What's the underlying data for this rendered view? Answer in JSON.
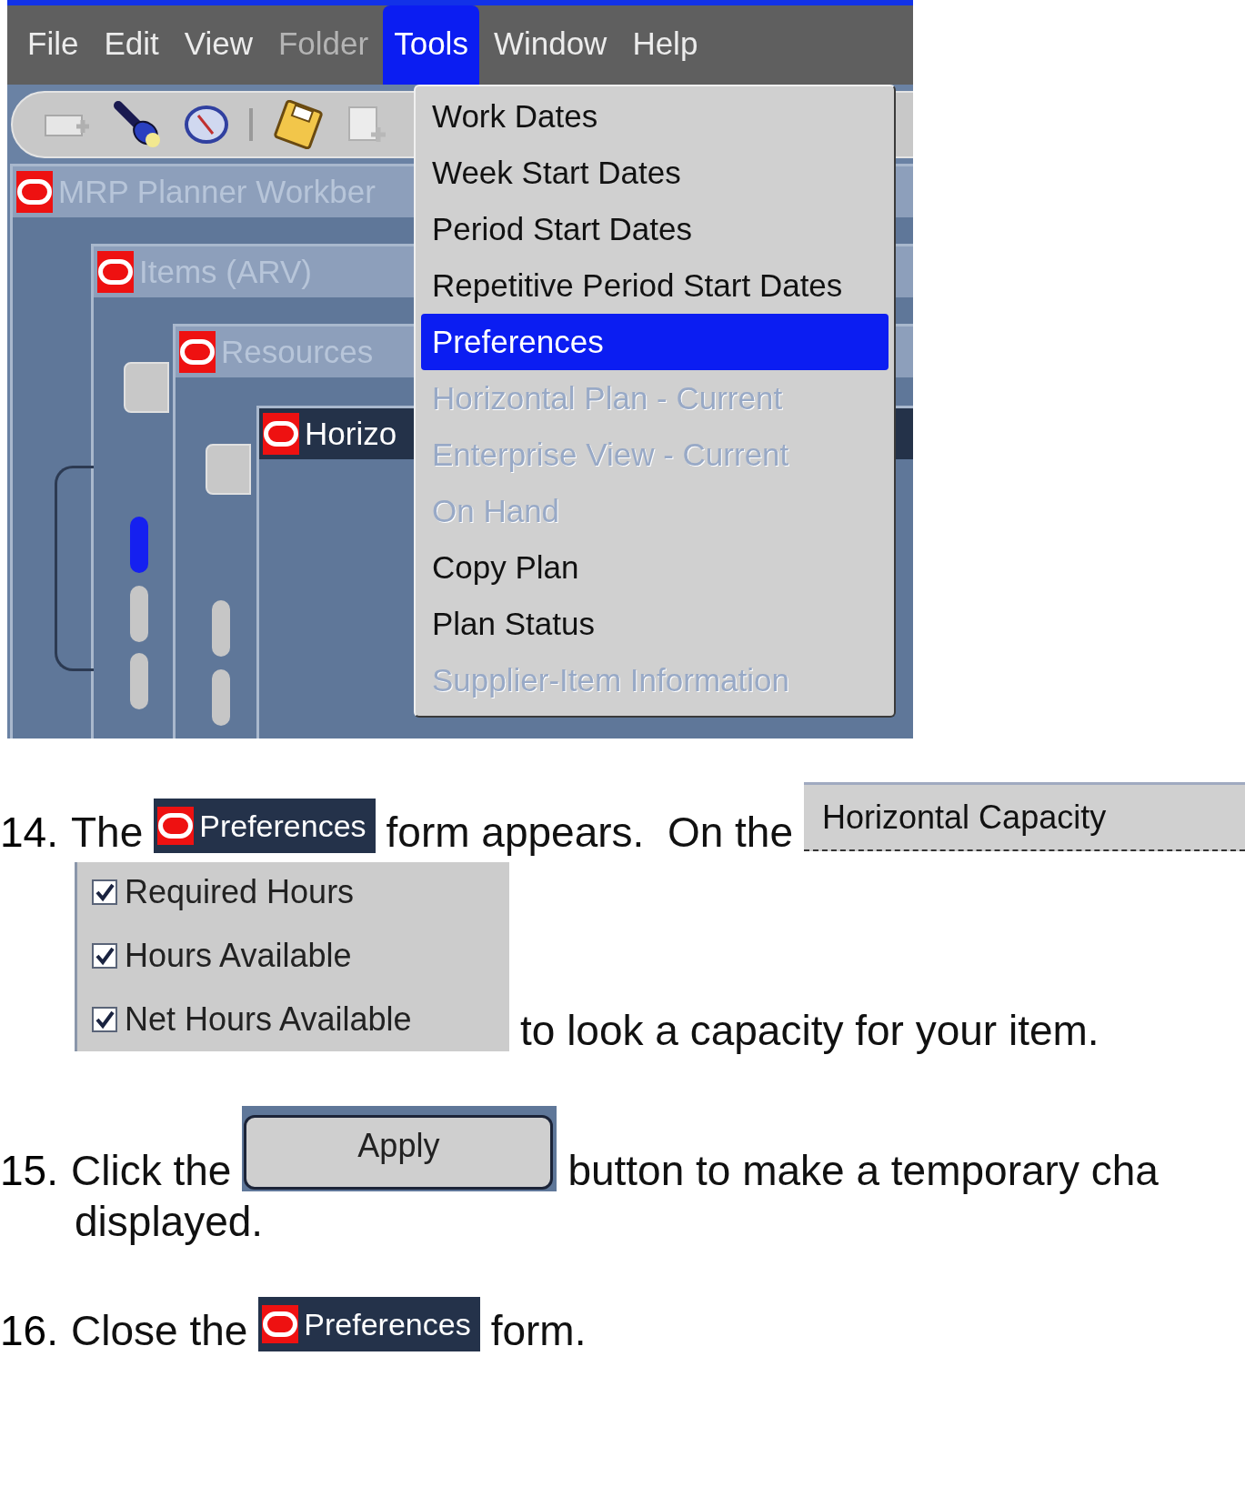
{
  "app_screenshot": {
    "menu_bar": [
      {
        "label": "File",
        "disabled": false,
        "selected": false
      },
      {
        "label": "Edit",
        "disabled": false,
        "selected": false
      },
      {
        "label": "View",
        "disabled": false,
        "selected": false
      },
      {
        "label": "Folder",
        "disabled": true,
        "selected": false
      },
      {
        "label": "Tools",
        "disabled": false,
        "selected": true
      },
      {
        "label": "Window",
        "disabled": false,
        "selected": false
      },
      {
        "label": "Help",
        "disabled": false,
        "selected": false
      }
    ],
    "windows": [
      {
        "title": "MRP Planner Workber",
        "active": false
      },
      {
        "title": "Items (ARV)",
        "active": false
      },
      {
        "title": "Resources",
        "active": false
      },
      {
        "title": "Horizo",
        "active": true
      }
    ],
    "tools_menu": [
      {
        "label": "Work Dates",
        "disabled": false,
        "selected": false
      },
      {
        "label": "Week Start Dates",
        "disabled": false,
        "selected": false
      },
      {
        "label": "Period Start Dates",
        "disabled": false,
        "selected": false
      },
      {
        "label": "Repetitive Period Start Dates",
        "disabled": false,
        "selected": false
      },
      {
        "label": "Preferences",
        "disabled": false,
        "selected": true
      },
      {
        "label": "Horizontal Plan - Current",
        "disabled": true,
        "selected": false
      },
      {
        "label": "Enterprise View - Current",
        "disabled": true,
        "selected": false
      },
      {
        "label": "On Hand",
        "disabled": true,
        "selected": false
      },
      {
        "label": "Copy Plan",
        "disabled": false,
        "selected": false
      },
      {
        "label": "Plan Status",
        "disabled": false,
        "selected": false
      },
      {
        "label": "Supplier-Item Information",
        "disabled": true,
        "selected": false
      }
    ]
  },
  "step_14": {
    "number": "14.",
    "text_before": "The",
    "form_title": "Preferences",
    "text_middle": "form appears.  On the",
    "tab": "Horizontal Capacity",
    "checkboxes": [
      {
        "label": "Required Hours",
        "checked": true
      },
      {
        "label": "Hours Available",
        "checked": true
      },
      {
        "label": "Net Hours Available",
        "checked": true
      }
    ],
    "text_after": "to look a capacity for your item."
  },
  "step_15": {
    "number": "15.",
    "text_before": "Click the",
    "button": "Apply",
    "text_after": "button to make a temporary cha",
    "continuation": "displayed."
  },
  "step_16": {
    "number": "16.",
    "text_before": "Close the",
    "form_title": "Preferences",
    "text_after": "form."
  }
}
